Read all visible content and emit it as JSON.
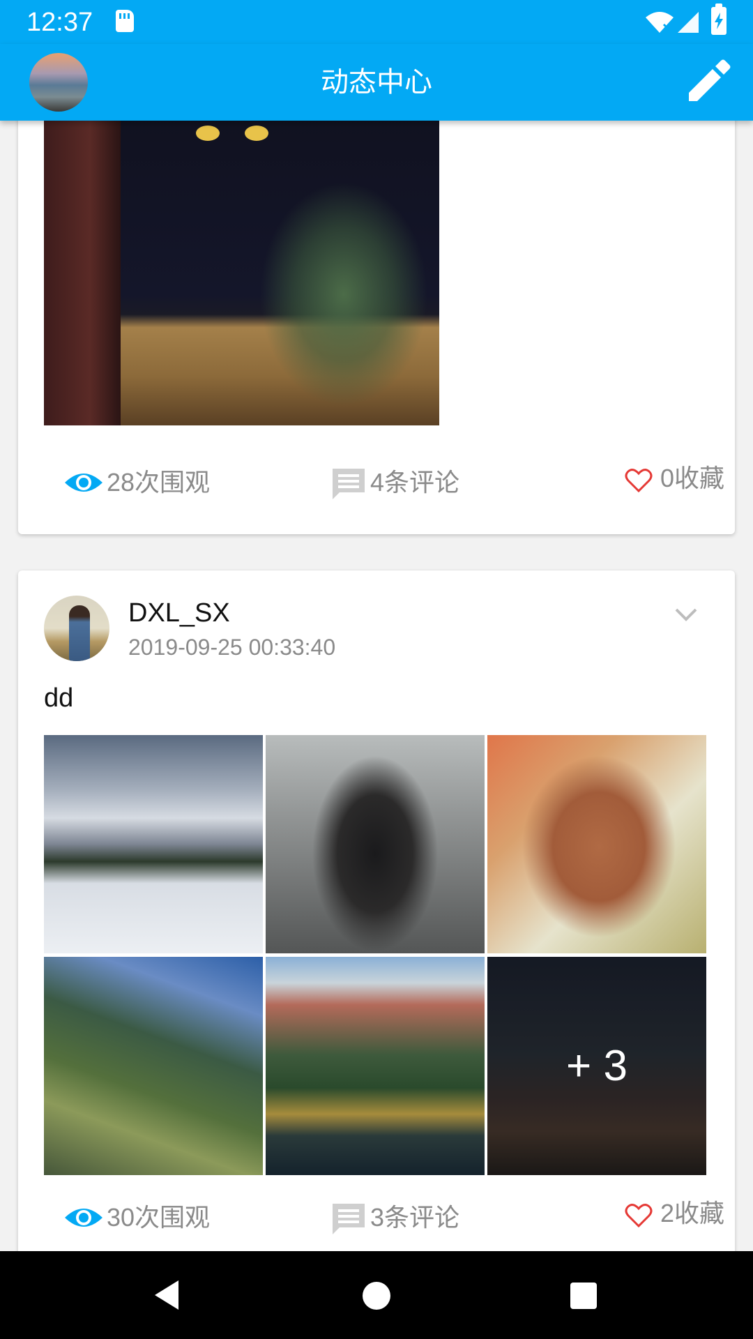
{
  "status_bar": {
    "time": "12:37"
  },
  "app_bar": {
    "title": "动态中心"
  },
  "posts": [
    {
      "stats": {
        "views": "28次围观",
        "comments": "4条评论",
        "favorites": "0收藏"
      }
    },
    {
      "username": "DXL_SX",
      "timestamp": "2019-09-25 00:33:40",
      "text": "dd",
      "images": [
        "mountain-snow",
        "motorcycle-rider",
        "poodle",
        "valley-road",
        "mountain-lake",
        "night-sky-peak"
      ],
      "more_count": "+ 3",
      "stats": {
        "views": "30次围观",
        "comments": "3条评论",
        "favorites": "2收藏"
      }
    }
  ],
  "colors": {
    "primary": "#03a9f4",
    "heart": "#e53935",
    "stat_text": "#8a8a8a"
  },
  "icons": [
    "sd-card-icon",
    "wifi-icon",
    "signal-icon",
    "battery-icon",
    "edit-icon",
    "eye-icon",
    "comment-icon",
    "heart-icon",
    "chevron-down-icon",
    "back-icon",
    "home-icon",
    "recents-icon"
  ]
}
